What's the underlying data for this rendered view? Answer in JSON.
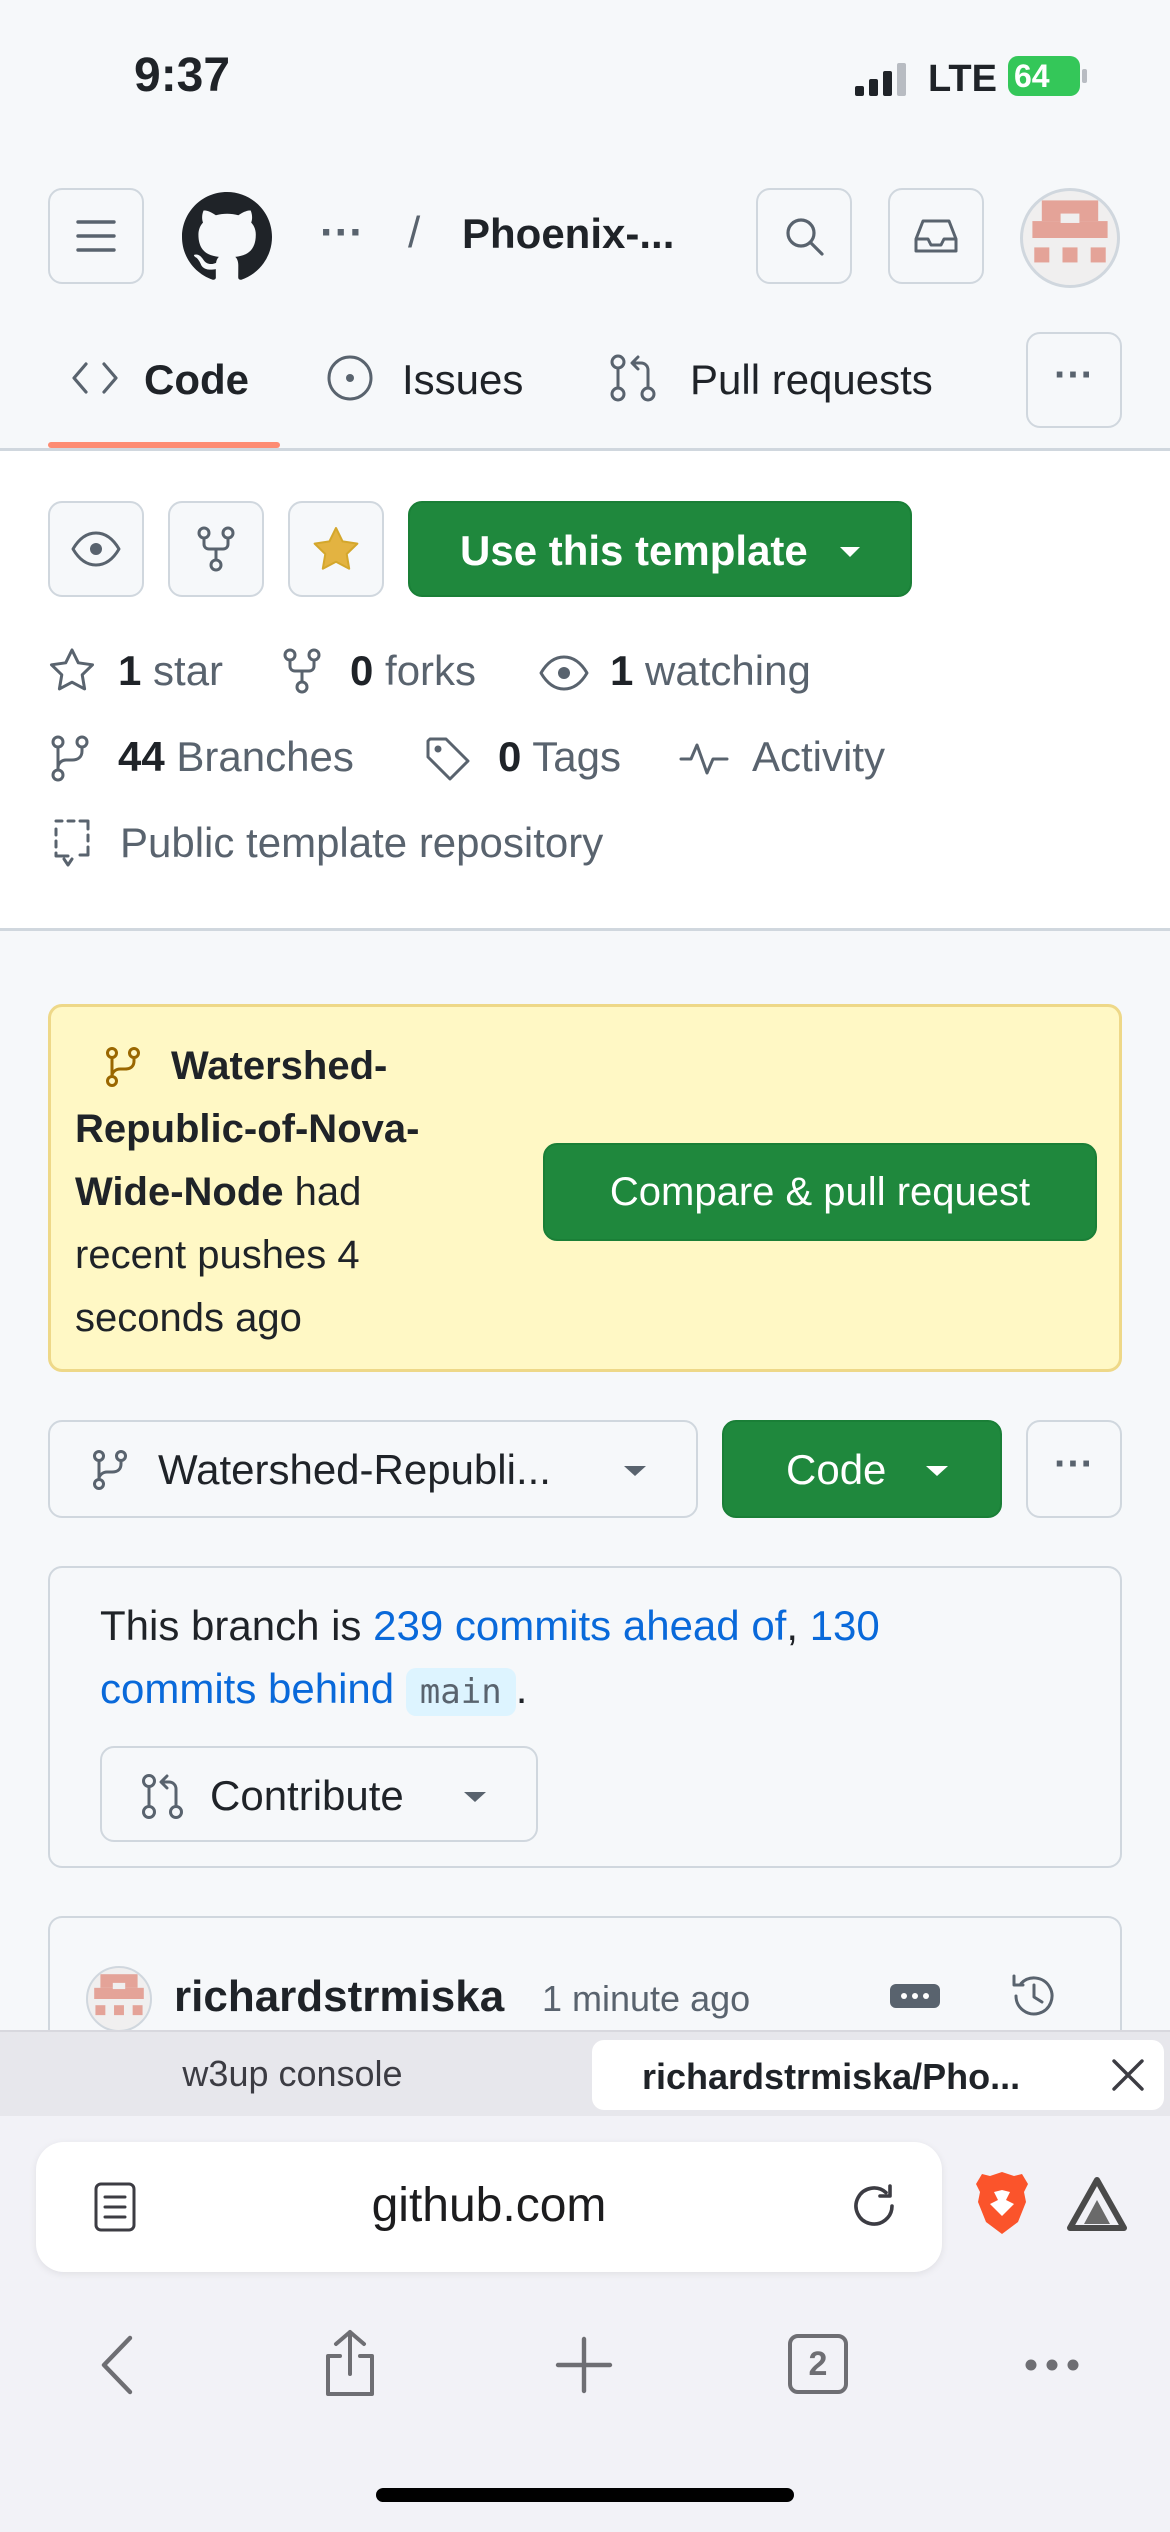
{
  "status_bar": {
    "time": "9:37",
    "network": "LTE",
    "battery": "64"
  },
  "header": {
    "ellipsis": "···",
    "slash": "/",
    "repo_name": "Phoenix-..."
  },
  "tabs": {
    "code": "Code",
    "issues": "Issues",
    "pull_requests": "Pull requests",
    "more": "···"
  },
  "actions": {
    "use_template": "Use this template"
  },
  "stats": {
    "stars_count": "1",
    "stars_label": "star",
    "forks_count": "0",
    "forks_label": "forks",
    "watching_count": "1",
    "watching_label": "watching",
    "branches_count": "44",
    "branches_label": "Branches",
    "tags_count": "0",
    "tags_label": "Tags",
    "activity_label": "Activity",
    "visibility": "Public template repository"
  },
  "banner": {
    "branch_line1": "Watershed-",
    "branch_line2": "Republic-of-Nova-",
    "branch_line3": "Wide-Node",
    "text_after": " had",
    "line4": "recent pushes 4",
    "line5": "seconds ago",
    "compare_button": "Compare & pull request"
  },
  "branch_selector": {
    "label": "Watershed-Republi...",
    "code_button": "Code",
    "more": "···"
  },
  "branch_info": {
    "prefix": "This branch is ",
    "ahead_link": "239 commits ahead of",
    "comma": ", ",
    "behind_link_part1": "130",
    "behind_link_part2": "commits behind",
    "base_branch": "main",
    "period": ".",
    "contribute": "Contribute"
  },
  "commit": {
    "author": "richardstrmiska",
    "time": "1 minute ago"
  },
  "browser": {
    "tab_inactive": "w3up console",
    "tab_active": "richardstrmiska/Pho...",
    "url": "github.com",
    "tab_count": "2"
  },
  "colors": {
    "accent_green": "#1f883d",
    "link_blue": "#0969da",
    "banner_bg": "#fff8c5",
    "tab_underline": "#fd8c73"
  }
}
